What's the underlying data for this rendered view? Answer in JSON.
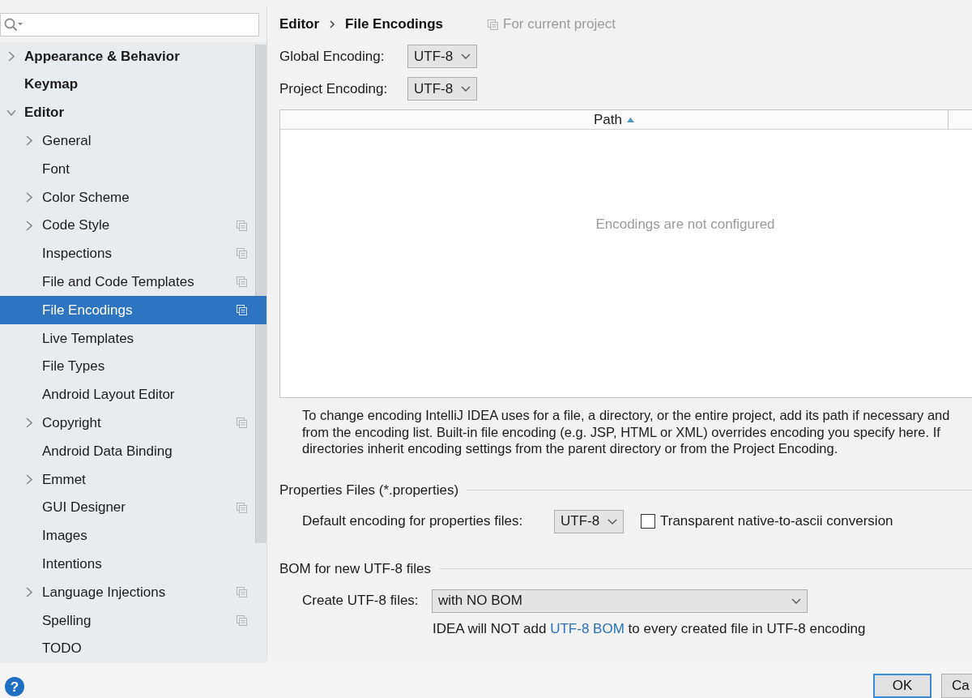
{
  "sidebar": {
    "items": [
      {
        "label": "Appearance & Behavior",
        "kind": "group",
        "expanded": false,
        "selected": false,
        "project_scope": false
      },
      {
        "label": "Keymap",
        "kind": "page",
        "selected": false,
        "project_scope": false
      },
      {
        "label": "Editor",
        "kind": "group",
        "expanded": true,
        "selected": false,
        "project_scope": false,
        "children": [
          {
            "label": "General",
            "kind": "group",
            "expanded": false,
            "selected": false,
            "project_scope": false
          },
          {
            "label": "Font",
            "kind": "page",
            "selected": false,
            "project_scope": false
          },
          {
            "label": "Color Scheme",
            "kind": "group",
            "expanded": false,
            "selected": false,
            "project_scope": false
          },
          {
            "label": "Code Style",
            "kind": "group",
            "expanded": false,
            "selected": false,
            "project_scope": true
          },
          {
            "label": "Inspections",
            "kind": "page",
            "selected": false,
            "project_scope": true
          },
          {
            "label": "File and Code Templates",
            "kind": "page",
            "selected": false,
            "project_scope": true
          },
          {
            "label": "File Encodings",
            "kind": "page",
            "selected": true,
            "project_scope": true
          },
          {
            "label": "Live Templates",
            "kind": "page",
            "selected": false,
            "project_scope": false
          },
          {
            "label": "File Types",
            "kind": "page",
            "selected": false,
            "project_scope": false
          },
          {
            "label": "Android Layout Editor",
            "kind": "page",
            "selected": false,
            "project_scope": false
          },
          {
            "label": "Copyright",
            "kind": "group",
            "expanded": false,
            "selected": false,
            "project_scope": true
          },
          {
            "label": "Android Data Binding",
            "kind": "page",
            "selected": false,
            "project_scope": false
          },
          {
            "label": "Emmet",
            "kind": "group",
            "expanded": false,
            "selected": false,
            "project_scope": false
          },
          {
            "label": "GUI Designer",
            "kind": "page",
            "selected": false,
            "project_scope": true
          },
          {
            "label": "Images",
            "kind": "page",
            "selected": false,
            "project_scope": false
          },
          {
            "label": "Intentions",
            "kind": "page",
            "selected": false,
            "project_scope": false
          },
          {
            "label": "Language Injections",
            "kind": "group",
            "expanded": false,
            "selected": false,
            "project_scope": true
          },
          {
            "label": "Spelling",
            "kind": "page",
            "selected": false,
            "project_scope": true
          },
          {
            "label": "TODO",
            "kind": "page",
            "selected": false,
            "project_scope": false
          }
        ]
      }
    ]
  },
  "header": {
    "breadcrumb": [
      "Editor",
      "File Encodings"
    ],
    "scope": "For current project"
  },
  "global_encoding": {
    "label": "Global Encoding:",
    "value": "UTF-8"
  },
  "project_encoding": {
    "label": "Project Encoding:",
    "value": "UTF-8"
  },
  "table": {
    "columns": [
      {
        "label": "Path",
        "sort_ascending": true
      }
    ],
    "empty_text": "Encodings are not configured"
  },
  "description": [
    "To change encoding IntelliJ IDEA uses for a file, a directory, or the entire project, add its path if necessary and",
    "from the encoding list. Built-in file encoding (e.g. JSP, HTML or XML) overrides encoding you specify here. If",
    "directories inherit encoding settings from the parent directory or from the Project Encoding."
  ],
  "properties_files": {
    "title": "Properties Files (*.properties)",
    "default_encoding": {
      "label": "Default encoding for properties files:",
      "value": "UTF-8"
    },
    "transparent_conversion": {
      "label": "Transparent native-to-ascii conversion",
      "checked": false
    }
  },
  "bom": {
    "title": "BOM for new UTF-8 files",
    "create": {
      "label": "Create UTF-8 files:",
      "value": "with NO BOM"
    },
    "note": {
      "before": "IDEA will NOT add ",
      "link": "UTF-8 BOM",
      "after": " to every created file in UTF-8 encoding"
    }
  },
  "footer": {
    "help": "?",
    "buttons": [
      {
        "label": "OK",
        "default": true
      },
      {
        "label": "Ca",
        "default": false
      }
    ]
  }
}
